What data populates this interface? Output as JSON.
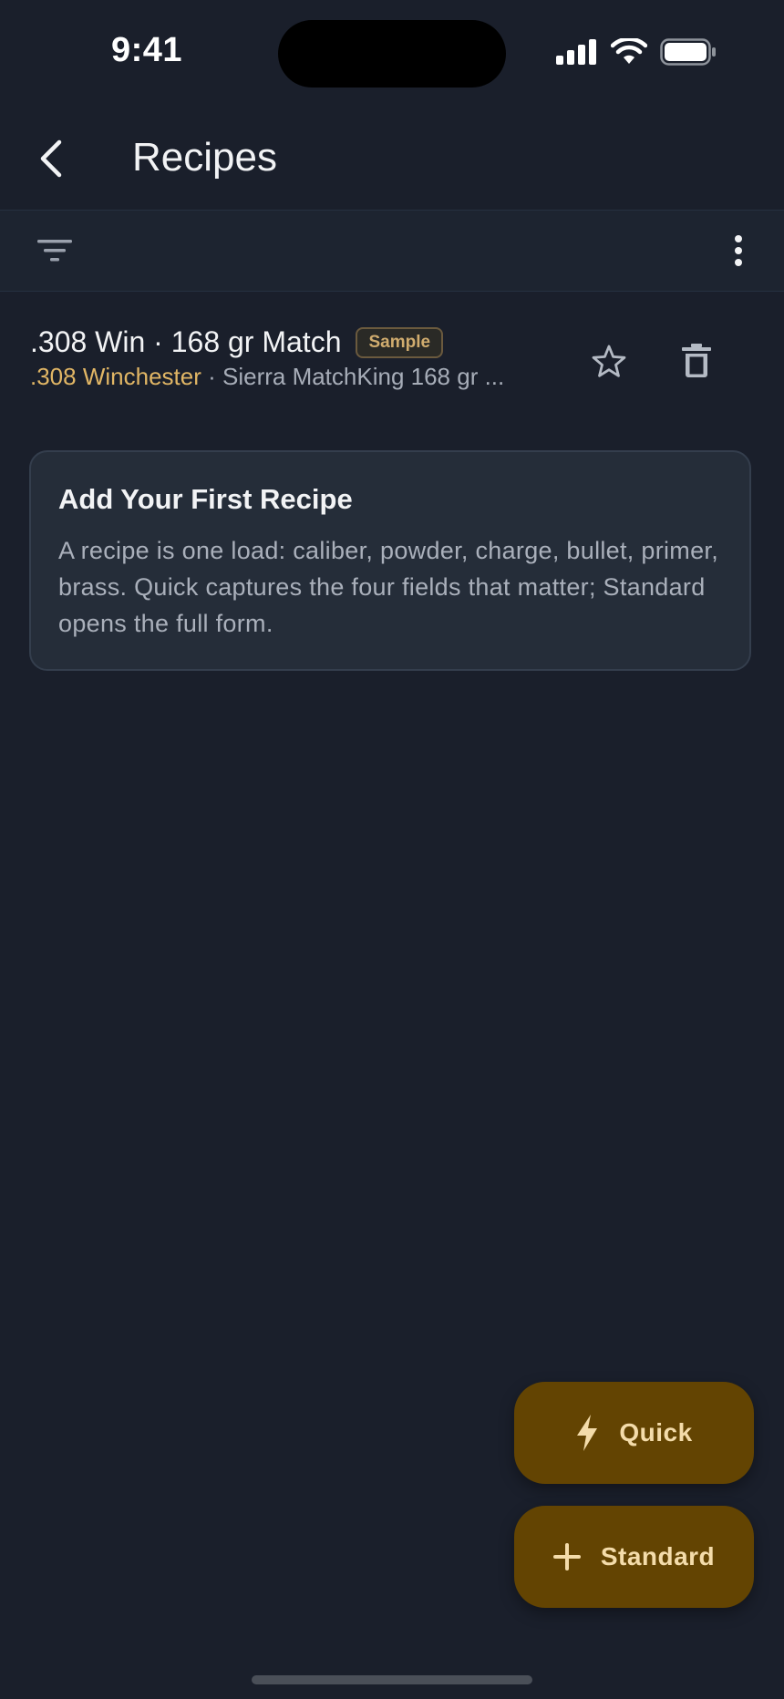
{
  "status_bar": {
    "time": "9:41"
  },
  "app_bar": {
    "title": "Recipes"
  },
  "recipe": {
    "name": ".308 Win · 168 gr Match",
    "badge": "Sample",
    "caliber": ".308 Winchester",
    "separator": " · ",
    "bullet": "Sierra MatchKing 168 gr ..."
  },
  "card": {
    "title": "Add Your First Recipe",
    "body": "A recipe is one load: caliber, powder, charge, bullet, primer, brass. Quick captures the four fields that matter; Standard opens the full form."
  },
  "fabs": {
    "quick_label": "Quick",
    "standard_label": "Standard"
  },
  "icons": {
    "back": "chevron-left-icon",
    "filter": "filter-icon",
    "more": "more-vertical-icon",
    "star": "star-outline-icon",
    "trash": "trash-icon",
    "bolt": "bolt-icon",
    "plus": "plus-icon"
  },
  "colors": {
    "background": "#1a1f2b",
    "accent": "#e1b665",
    "fab_bg": "#634402",
    "fab_text": "#f4dcaa"
  }
}
